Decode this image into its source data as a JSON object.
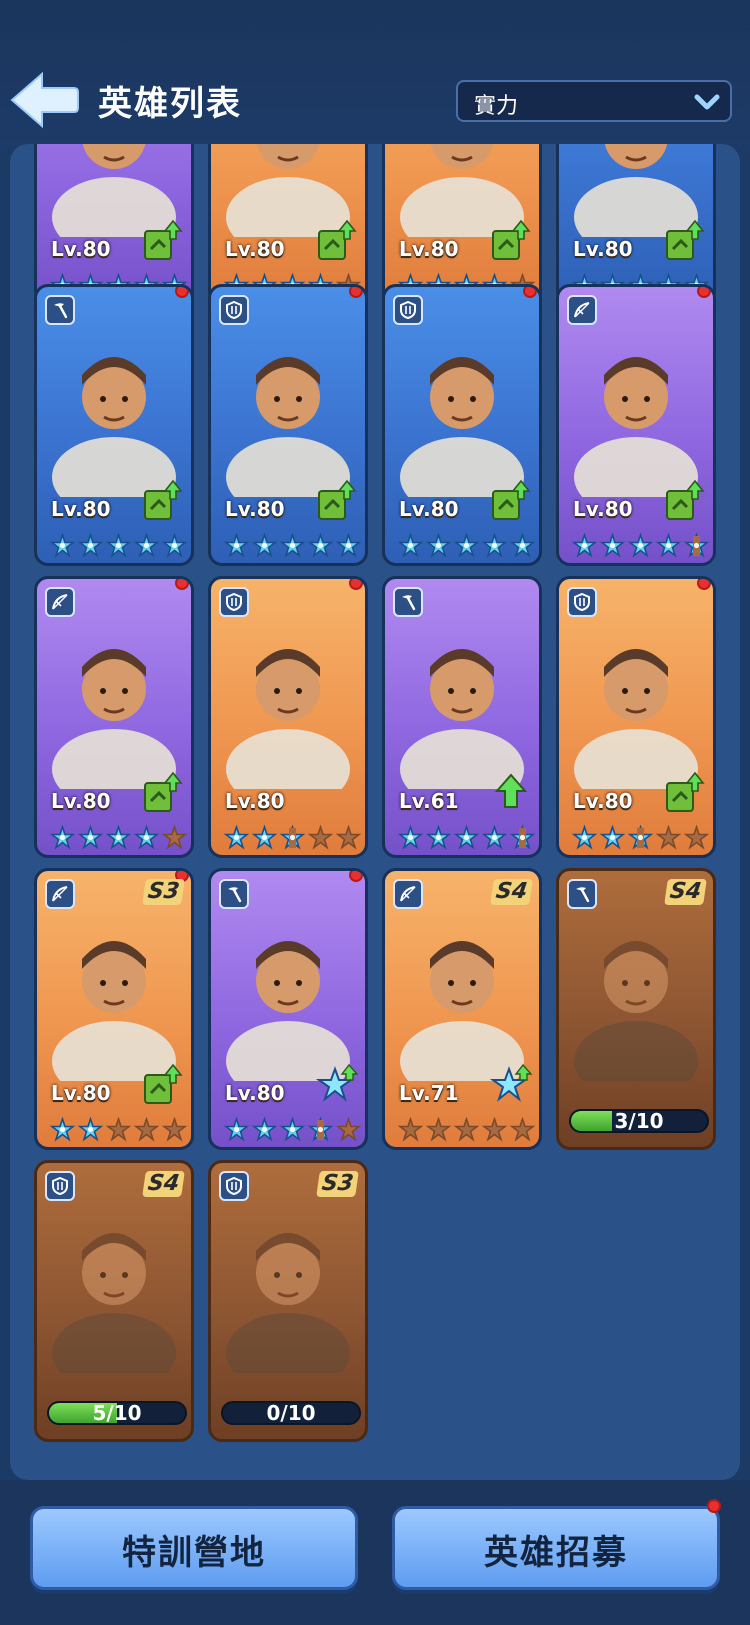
{
  "header": {
    "title": "英雄列表",
    "sort": {
      "selected": "實力"
    }
  },
  "heroes": [
    {
      "name_icon": "hero-portrait",
      "class": "pickaxe",
      "bg": "purple",
      "level": "Lv.80",
      "stars": "5",
      "upgrade": true,
      "dot": false
    },
    {
      "name_icon": "hero-portrait",
      "class": "pickaxe",
      "bg": "orange",
      "level": "Lv.80",
      "stars": "4",
      "upgrade": true,
      "dot": false
    },
    {
      "name_icon": "hero-portrait",
      "class": "pickaxe",
      "bg": "orange",
      "level": "Lv.80",
      "stars": "4",
      "upgrade": true,
      "dot": false
    },
    {
      "name_icon": "hero-portrait",
      "class": "pickaxe",
      "bg": "blue",
      "level": "Lv.80",
      "stars": "5",
      "upgrade": true,
      "dot": false
    },
    {
      "class": "pickaxe",
      "bg": "blue",
      "level": "Lv.80",
      "stars": "5",
      "upgrade": true,
      "dot": true
    },
    {
      "class": "shield",
      "bg": "blue",
      "level": "Lv.80",
      "stars": "5",
      "upgrade": true,
      "dot": true
    },
    {
      "class": "shield",
      "bg": "blue",
      "level": "Lv.80",
      "stars": "5",
      "upgrade": true,
      "dot": true
    },
    {
      "class": "bow",
      "bg": "purple",
      "level": "Lv.80",
      "stars": "4.5",
      "upgrade": true,
      "dot": true
    },
    {
      "class": "bow",
      "bg": "purple",
      "level": "Lv.80",
      "stars": "4",
      "upgrade": true,
      "dot": true
    },
    {
      "class": "shield",
      "bg": "orange",
      "level": "Lv.80",
      "stars": "2.5",
      "upgrade": false,
      "dot": true
    },
    {
      "class": "pickaxe",
      "bg": "purple",
      "level": "Lv.61",
      "stars": "4.5",
      "upgrade": "arrow",
      "dot": false
    },
    {
      "class": "shield",
      "bg": "orange",
      "level": "Lv.80",
      "stars": "2.5",
      "upgrade": true,
      "dot": true
    },
    {
      "class": "bow",
      "bg": "orange",
      "tier": "S3",
      "level": "Lv.80",
      "stars": "2",
      "upgrade": true,
      "dot": true
    },
    {
      "class": "pickaxe",
      "bg": "purple",
      "level": "Lv.80",
      "stars": "3.5",
      "upgrade": "star",
      "dot": true
    },
    {
      "class": "bow",
      "bg": "orange",
      "tier": "S4",
      "level": "Lv.71",
      "stars": "0",
      "upgrade": "star",
      "dot": false
    },
    {
      "class": "pickaxe",
      "bg": "brown",
      "tier": "S4",
      "progress": "3/10",
      "progress_value": 0.3,
      "dot": false
    },
    {
      "class": "shield",
      "bg": "brown",
      "tier": "S4",
      "progress": "5/10",
      "progress_value": 0.5,
      "dot": false
    },
    {
      "class": "shield",
      "bg": "brown",
      "tier": "S3",
      "progress": "0/10",
      "progress_value": 0,
      "dot": false
    }
  ],
  "footer": {
    "left_button": "特訓營地",
    "right_button": "英雄招募"
  },
  "colors": {
    "accent_blue": "#5e9cf0",
    "star_cyan": "#5fd3f0",
    "notify_red": "#e8302e",
    "progress_green": "#3fa32e"
  }
}
